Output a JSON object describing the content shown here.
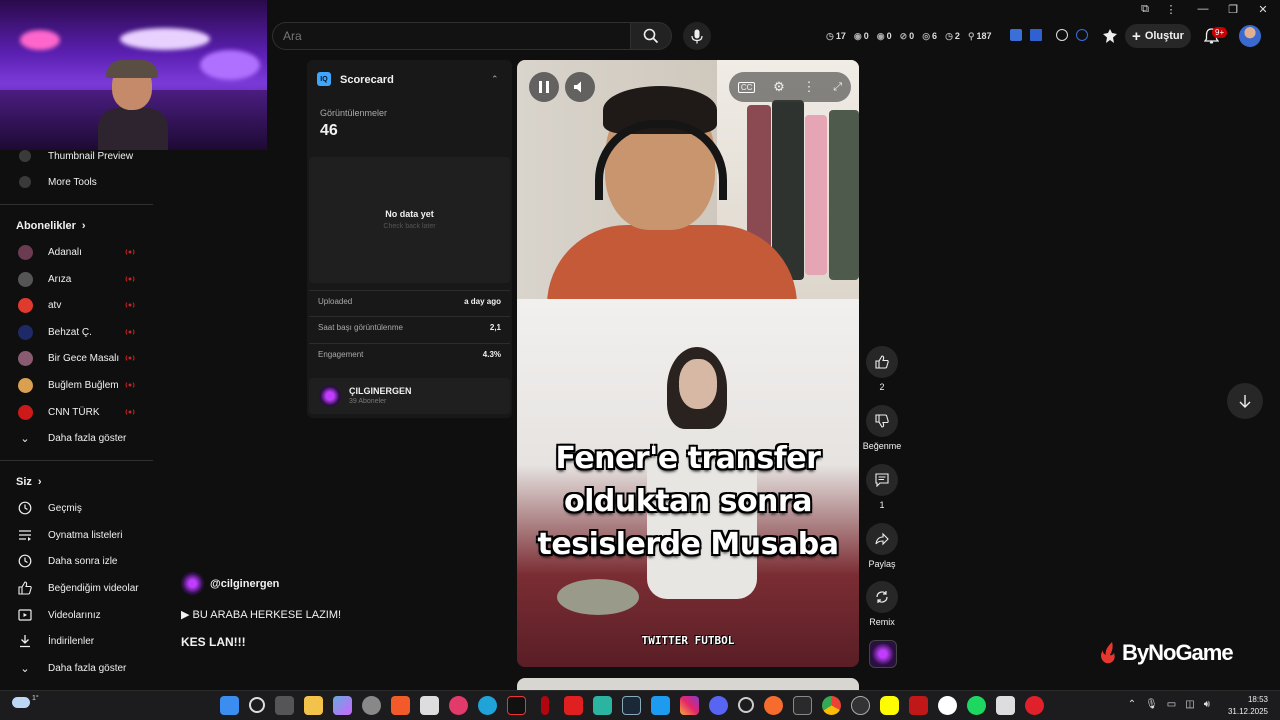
{
  "search": {
    "placeholder": "Ara"
  },
  "stats": [
    {
      "icon": "clock-icon",
      "value": "17"
    },
    {
      "icon": "eye-icon",
      "value": "0"
    },
    {
      "icon": "eye-icon",
      "value": "0"
    },
    {
      "icon": "tag-icon",
      "value": "0"
    },
    {
      "icon": "view-icon",
      "value": "6"
    },
    {
      "icon": "clock-icon",
      "value": "2"
    },
    {
      "icon": "person-icon",
      "value": "187"
    }
  ],
  "header": {
    "create_label": "Oluştur",
    "notifications_badge": "9+"
  },
  "sidebar": {
    "tools": [
      {
        "label": "Thumbnail Preview",
        "icon": "iq-icon"
      },
      {
        "label": "More Tools",
        "icon": "iq-icon"
      }
    ],
    "subscriptions_title": "Abonelikler",
    "subscriptions": [
      {
        "label": "Adanalı",
        "color": "#6b3b52"
      },
      {
        "label": "Arıza",
        "color": "#555555"
      },
      {
        "label": "atv",
        "color": "#e03a2f"
      },
      {
        "label": "Behzat Ç.",
        "color": "#1e2a66"
      },
      {
        "label": "Bir Gece Masalı",
        "color": "#8a5a70"
      },
      {
        "label": "Buğlem Buğlem",
        "color": "#d8a050"
      },
      {
        "label": "CNN TÜRK",
        "color": "#cc1a1a"
      }
    ],
    "subs_more": "Daha fazla göster",
    "you_title": "Siz",
    "you_items": [
      {
        "label": "Geçmiş",
        "icon": "history-icon"
      },
      {
        "label": "Oynatma listeleri",
        "icon": "playlist-icon"
      },
      {
        "label": "Daha sonra izle",
        "icon": "watch-later-icon"
      },
      {
        "label": "Beğendiğim videolar",
        "icon": "like-icon"
      },
      {
        "label": "Videolarınız",
        "icon": "video-icon"
      },
      {
        "label": "İndirilenler",
        "icon": "download-icon"
      },
      {
        "label": "Daha fazla göster",
        "icon": "chevron-down-icon"
      }
    ]
  },
  "scorecard": {
    "logo": "IQ",
    "title": "Scorecard",
    "views_label": "Görüntülenmeler",
    "views": "46",
    "no_data": "No data yet",
    "check_back": "Check back later",
    "rows": [
      {
        "key": "Uploaded",
        "value": "a day ago"
      },
      {
        "key": "Saat başı görüntülenme",
        "value": "2,1"
      },
      {
        "key": "Engagement",
        "value": "4.3%"
      }
    ],
    "channel_name": "ÇILGINERGEN",
    "channel_subs": "39 Aboneler"
  },
  "video": {
    "caption": [
      "Fener'e transfer",
      "olduktan sonra",
      "tesislerde Musaba"
    ],
    "watermark": "TWITTER FUTBOL"
  },
  "actions": {
    "likes": "2",
    "dislike_label": "Beğenme",
    "comments": "1",
    "share_label": "Paylaş",
    "remix_label": "Remix"
  },
  "channel": {
    "handle": "@cilginergen",
    "music": "▶ BU ARABA HERKESE LAZIM!",
    "title": "KES LAN!!!"
  },
  "brand": {
    "logo_text": "ByNoGame"
  },
  "taskbar": {
    "weather_temp": "1°",
    "time": "18:53",
    "date": "31.12.2025",
    "apps": [
      "windows-icon",
      "search-icon",
      "taskview-icon",
      "folder-icon",
      "copilot-icon",
      "settings-icon",
      "brave-icon",
      "store-icon",
      "media-icon",
      "edge-icon",
      "tiktok-icon",
      "netflix-icon",
      "youtube-icon",
      "app-icon",
      "steam-icon",
      "twitter-icon",
      "instagram-icon",
      "discord-icon",
      "speedtest-icon",
      "origin-icon",
      "epic-icon",
      "chrome-icon",
      "obs-icon",
      "snapchat-icon",
      "mcafee-icon",
      "yandex-icon",
      "spotify-icon",
      "calendar-icon",
      "opera-icon"
    ]
  }
}
